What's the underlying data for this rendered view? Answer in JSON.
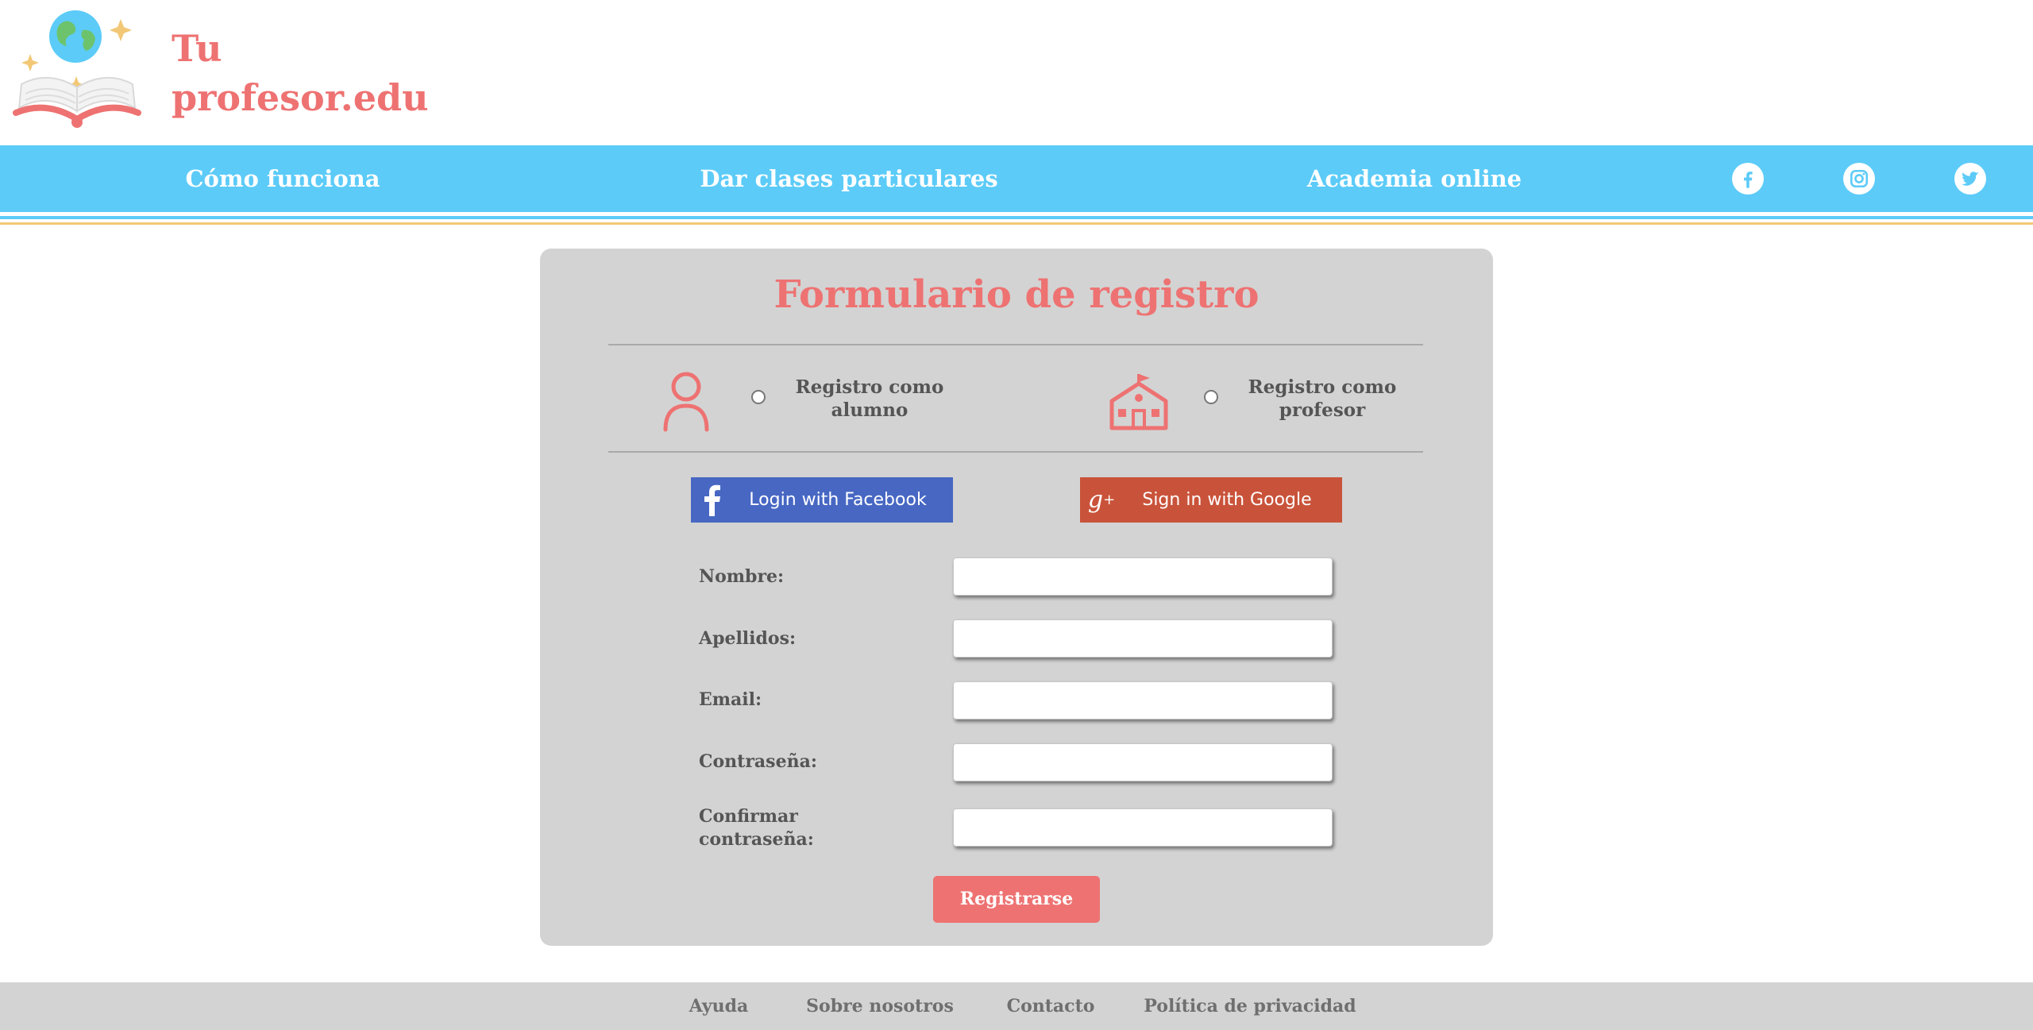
{
  "brand": {
    "name_line1": "Tu",
    "name_line2": "profesor.edu",
    "color": "#ee7272"
  },
  "nav": {
    "items": [
      {
        "label": "Cómo funciona"
      },
      {
        "label": "Dar clases particulares"
      },
      {
        "label": "Academia online"
      }
    ],
    "social_icons": [
      "facebook-icon",
      "instagram-icon",
      "twitter-icon"
    ],
    "bar_color": "#5ccbf8"
  },
  "form": {
    "title": "Formulario de registro",
    "roles": [
      {
        "label": "Registro como alumno",
        "icon": "student-icon"
      },
      {
        "label": "Registro como profesor",
        "icon": "school-icon"
      }
    ],
    "facebook_button": "Login with Facebook",
    "google_button": "Sign in with Google",
    "fields": [
      {
        "label": "Nombre:",
        "value": ""
      },
      {
        "label": "Apellidos:",
        "value": ""
      },
      {
        "label": "Email:",
        "value": ""
      },
      {
        "label": "Contraseña:",
        "value": ""
      },
      {
        "label": "Confirmar contraseña:",
        "value": ""
      }
    ],
    "submit": "Registrarse"
  },
  "footer": {
    "links": [
      {
        "label": "Ayuda"
      },
      {
        "label": "Sobre nosotros"
      },
      {
        "label": "Contacto"
      },
      {
        "label": "Política de privacidad"
      }
    ]
  }
}
